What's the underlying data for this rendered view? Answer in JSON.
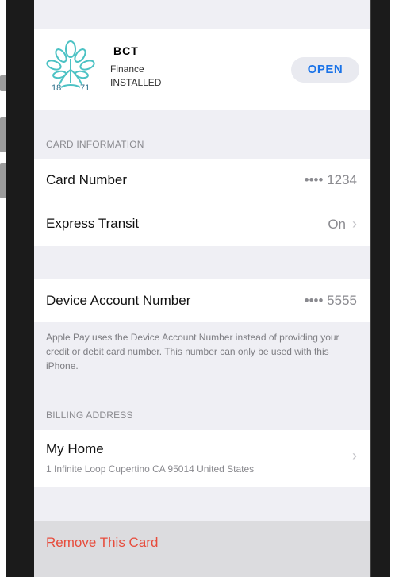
{
  "app": {
    "name": "BCT",
    "category": "Finance",
    "status": "INSTALLED",
    "open_label": "OPEN",
    "logo_left_number": "18",
    "logo_right_number": "71",
    "brand_color": "#4cc2c4"
  },
  "card_info": {
    "section_label": "CARD INFORMATION",
    "card_number_label": "Card Number",
    "card_number_value": "•••• 1234",
    "express_transit_label": "Express Transit",
    "express_transit_value": "On"
  },
  "device_account": {
    "label": "Device Account Number",
    "value": "•••• 5555",
    "footnote": "Apple Pay uses the Device Account Number instead of providing your credit or debit card number. This number can only be used with this iPhone."
  },
  "billing": {
    "section_label": "BILLING ADDRESS",
    "name": "My Home",
    "address": "1 Infinite Loop Cupertino CA 95014 United States"
  },
  "remove": {
    "label": "Remove This Card",
    "color": "#e74c3c"
  }
}
